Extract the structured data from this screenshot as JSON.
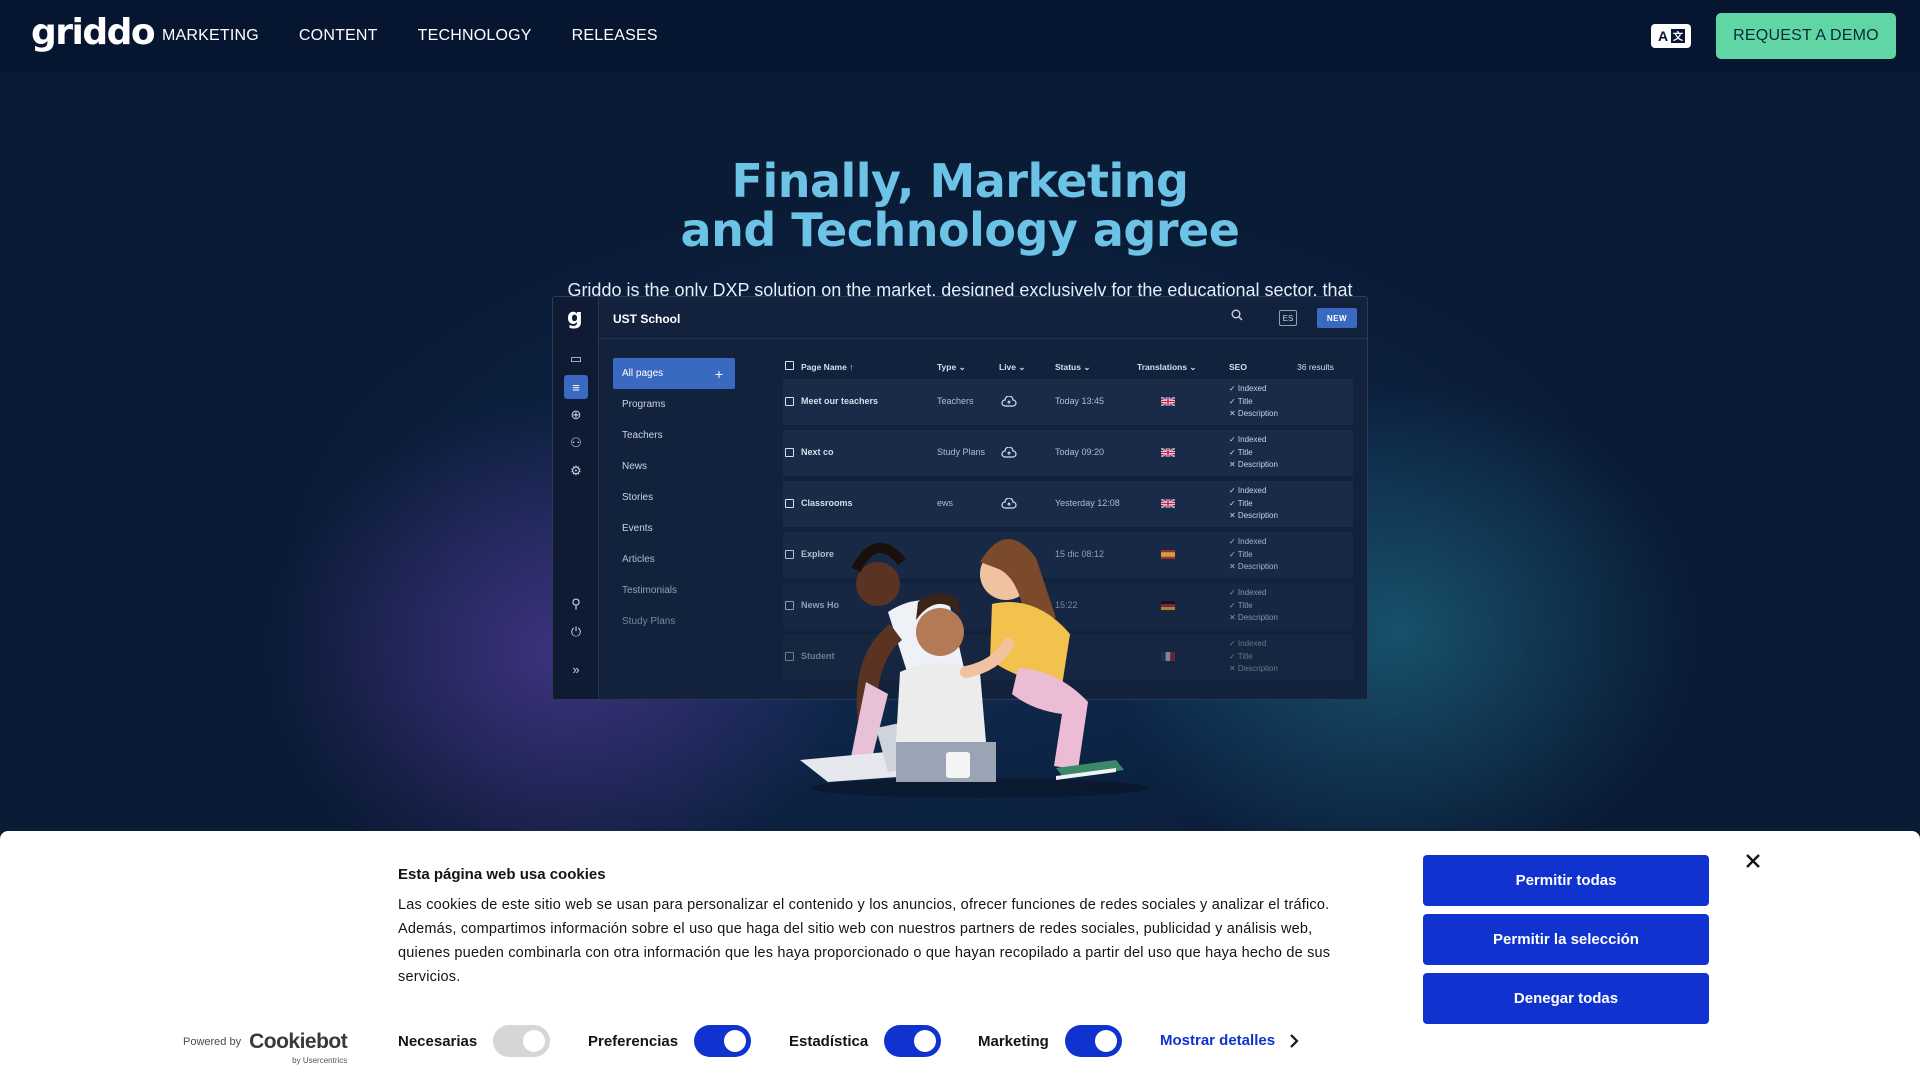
{
  "nav": {
    "logo": "griddo",
    "links": [
      "MARKETING",
      "CONTENT",
      "TECHNOLOGY",
      "RELEASES"
    ],
    "lang_icon": "translate-icon",
    "demo_label": "REQUEST A DEMO"
  },
  "hero": {
    "title_line1": "Finally, Marketing",
    "title_line2": "and Technology agree",
    "subtitle": "Griddo is the only DXP solution on the market, designed exclusively for the educational sector, that offers full autonomy to create and manage digital asset ecosystems easily and efficiently."
  },
  "dashboard": {
    "logo": "g",
    "site": "UST School",
    "lang": "ES",
    "new_label": "NEW",
    "menu": [
      "All pages",
      "Programs",
      "Teachers",
      "News",
      "Stories",
      "Events",
      "Articles",
      "Testimonials",
      "Study Plans"
    ],
    "menu_add": "+",
    "columns": {
      "page_name": "Page Name ↑",
      "type": "Type ⌄",
      "live": "Live ⌄",
      "status": "Status ⌄",
      "translations": "Translations ⌄",
      "seo": "SEO",
      "results": "36 results"
    },
    "rows": [
      {
        "name": "Meet our teachers",
        "type": "Teachers",
        "status": "Today 13:45",
        "flag": "uk"
      },
      {
        "name": "Next co",
        "type": "Study Plans",
        "status": "Today 09:20",
        "flag": "uk"
      },
      {
        "name": "Classrooms",
        "type": "ews",
        "status": "Yesterday 12:08",
        "flag": "uk"
      },
      {
        "name": "Explore",
        "type": "",
        "status": "15 dic 08:12",
        "flag": "es"
      },
      {
        "name": "News Ho",
        "type": "",
        "status": "15:22",
        "flag": "de"
      },
      {
        "name": "Student",
        "type": "",
        "status": "",
        "flag": "fr"
      }
    ],
    "seo_lines": [
      "✓ Indexed",
      "✓ Title",
      "✕ Description"
    ]
  },
  "cookie": {
    "title": "Esta página web usa cookies",
    "text": "Las cookies de este sitio web se usan para personalizar el contenido y los anuncios, ofrecer funciones de redes sociales y analizar el tráfico. Además, compartimos información sobre el uso que haga del sitio web con nuestros partners de redes sociales, publicidad y análisis web, quienes pueden combinarla con otra información que les haya proporcionado o que hayan recopilado a partir del uso que haya hecho de sus servicios.",
    "powered_by": "Powered by",
    "brand": "Cookiebot",
    "brand_sub": "by Usercentrics",
    "toggles": [
      {
        "label": "Necesarias",
        "on": true,
        "disabled": true
      },
      {
        "label": "Preferencias",
        "on": true
      },
      {
        "label": "Estadística",
        "on": true
      },
      {
        "label": "Marketing",
        "on": true
      }
    ],
    "details_label": "Mostrar detalles",
    "buttons": [
      "Permitir todas",
      "Permitir la selección",
      "Denegar todas"
    ]
  },
  "colors": {
    "nav_bg": "#071630",
    "hero_bg": "#0a1b36",
    "title": "#6cc3e6",
    "demo_button": "#5fd6a4",
    "cookie_accent": "#1032cf"
  }
}
